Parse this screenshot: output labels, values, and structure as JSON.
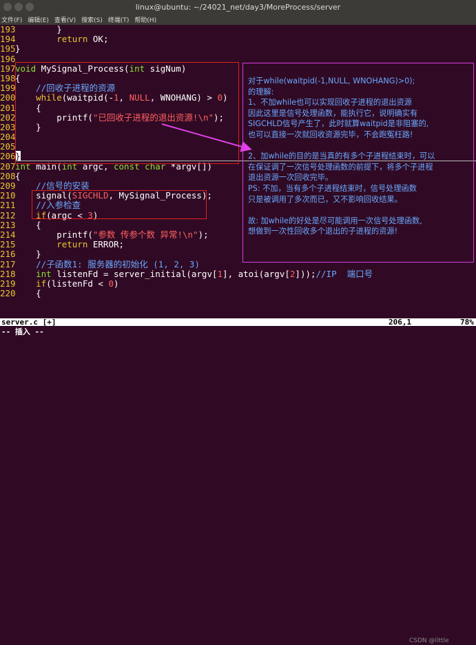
{
  "window": {
    "title": "linux@ubuntu: ~/24021_net/day3/MoreProcess/server"
  },
  "menu": [
    "文件(F)",
    "编辑(E)",
    "查看(V)",
    "搜索(S)",
    "终端(T)",
    "帮助(H)"
  ],
  "code": [
    {
      "ln": "193",
      "parts": [
        [
          "p",
          "        }"
        ]
      ]
    },
    {
      "ln": "194",
      "parts": [
        [
          "p",
          "        "
        ],
        [
          "k",
          "return"
        ],
        [
          "p",
          " OK;"
        ]
      ]
    },
    {
      "ln": "195",
      "parts": [
        [
          "p",
          "}"
        ]
      ]
    },
    {
      "ln": "196",
      "parts": [
        [
          "p",
          ""
        ]
      ]
    },
    {
      "ln": "197",
      "parts": [
        [
          "t",
          "void"
        ],
        [
          "p",
          " MySignal_Process("
        ],
        [
          "t",
          "int"
        ],
        [
          "p",
          " sigNum)"
        ]
      ]
    },
    {
      "ln": "198",
      "parts": [
        [
          "p",
          "{"
        ]
      ]
    },
    {
      "ln": "199",
      "parts": [
        [
          "c",
          "    //回收子进程的资源"
        ]
      ]
    },
    {
      "ln": "200",
      "parts": [
        [
          "k",
          "    while"
        ],
        [
          "p",
          "(waitpid(-"
        ],
        [
          "n",
          "1"
        ],
        [
          "p",
          ", "
        ],
        [
          "n",
          "NULL"
        ],
        [
          "p",
          ", WNOHANG) > "
        ],
        [
          "n",
          "0"
        ],
        [
          "p",
          ")"
        ]
      ]
    },
    {
      "ln": "201",
      "parts": [
        [
          "p",
          "    {"
        ]
      ]
    },
    {
      "ln": "202",
      "parts": [
        [
          "p",
          "        printf("
        ],
        [
          "s",
          "\"已回收子进程的退出资源!\\n\""
        ],
        [
          "p",
          ");"
        ]
      ]
    },
    {
      "ln": "203",
      "parts": [
        [
          "p",
          "    }"
        ]
      ]
    },
    {
      "ln": "204",
      "parts": [
        [
          "p",
          ""
        ]
      ]
    },
    {
      "ln": "205",
      "parts": [
        [
          "p",
          ""
        ]
      ]
    },
    {
      "ln": "206",
      "parts": [
        [
          "p",
          "}"
        ]
      ],
      "cursor": true
    },
    {
      "ln": "207",
      "parts": [
        [
          "t",
          "int"
        ],
        [
          "p",
          " main("
        ],
        [
          "t",
          "int"
        ],
        [
          "p",
          " argc, "
        ],
        [
          "t",
          "const"
        ],
        [
          "p",
          " "
        ],
        [
          "t",
          "char"
        ],
        [
          "p",
          " *argv[])"
        ]
      ]
    },
    {
      "ln": "208",
      "parts": [
        [
          "p",
          "{"
        ]
      ]
    },
    {
      "ln": "209",
      "parts": [
        [
          "c",
          "    //信号的安装"
        ]
      ]
    },
    {
      "ln": "210",
      "parts": [
        [
          "p",
          "    signal("
        ],
        [
          "n",
          "SIGCHLD"
        ],
        [
          "p",
          ", MySignal_Process);"
        ]
      ]
    },
    {
      "ln": "211",
      "parts": [
        [
          "c",
          "    //入参检查"
        ]
      ]
    },
    {
      "ln": "212",
      "parts": [
        [
          "k",
          "    if"
        ],
        [
          "p",
          "(argc < "
        ],
        [
          "n",
          "3"
        ],
        [
          "p",
          ")"
        ]
      ]
    },
    {
      "ln": "213",
      "parts": [
        [
          "p",
          "    {"
        ]
      ]
    },
    {
      "ln": "214",
      "parts": [
        [
          "p",
          "        printf("
        ],
        [
          "s",
          "\"参数 传参个数 异常!\\n\""
        ],
        [
          "p",
          ");"
        ]
      ]
    },
    {
      "ln": "215",
      "parts": [
        [
          "k",
          "        return"
        ],
        [
          "p",
          " ERROR;"
        ]
      ]
    },
    {
      "ln": "216",
      "parts": [
        [
          "p",
          "    }"
        ]
      ]
    },
    {
      "ln": "217",
      "parts": [
        [
          "c",
          "    //子函数1: 服务器的初始化 (1, 2, 3)"
        ]
      ]
    },
    {
      "ln": "218",
      "parts": [
        [
          "t",
          "    int"
        ],
        [
          "p",
          " listenFd = server_initial(argv["
        ],
        [
          "n",
          "1"
        ],
        [
          "p",
          "], atoi(argv["
        ],
        [
          "n",
          "2"
        ],
        [
          "p",
          "]));"
        ],
        [
          "c",
          "//IP  端口号"
        ]
      ]
    },
    {
      "ln": "219",
      "parts": [
        [
          "k",
          "    if"
        ],
        [
          "p",
          "(listenFd < "
        ],
        [
          "n",
          "0"
        ],
        [
          "p",
          ")"
        ]
      ]
    },
    {
      "ln": "220",
      "parts": [
        [
          "p",
          "    {"
        ]
      ]
    }
  ],
  "status": {
    "file": "server.c [+]",
    "position": "206,1",
    "percent": "78%",
    "watermark": "CSDN @little "
  },
  "mode": "-- 插入 --",
  "annotation": {
    "lines": [
      "对于while(waitpid(-1,NULL, WNOHANG)>0);",
      "的理解:",
      "1、不加while也可以实现回收子进程的退出资源",
      "因此这里是信号处理函数，能执行它，说明确实有",
      "SIGCHLD信号产生了，此时就算waitpid是非阻塞的,",
      "也可以直接一次就回收资源完毕，不会跑冤枉路!",
      "",
      "2、加while的目的是当真的有多个子进程结束时，可以",
      "在保证调了一次信号处理函数的前提下，将多个子进程",
      "退出资源一次回收完毕。",
      "PS: 不加，当有多个子进程结束时，信号处理函数",
      "只是被调用了多次而已，又不影响回收结果。",
      "",
      "故: 加while的好处是尽可能调用一次信号处理函数,",
      "想做到一次性回收多个退出的子进程的资源!"
    ]
  }
}
